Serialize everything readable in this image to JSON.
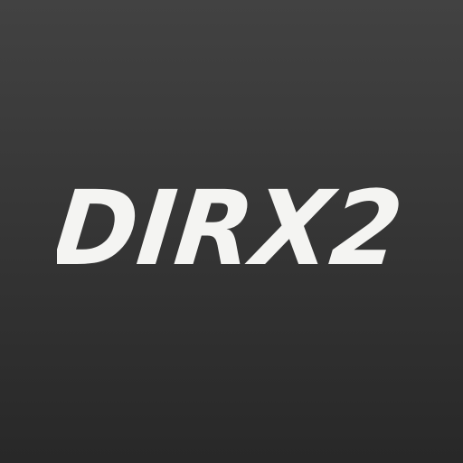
{
  "logo": {
    "text": "DIRX2"
  },
  "colors": {
    "background_top": "#424242",
    "background_bottom": "#282828",
    "text": "#f4f4f2"
  }
}
